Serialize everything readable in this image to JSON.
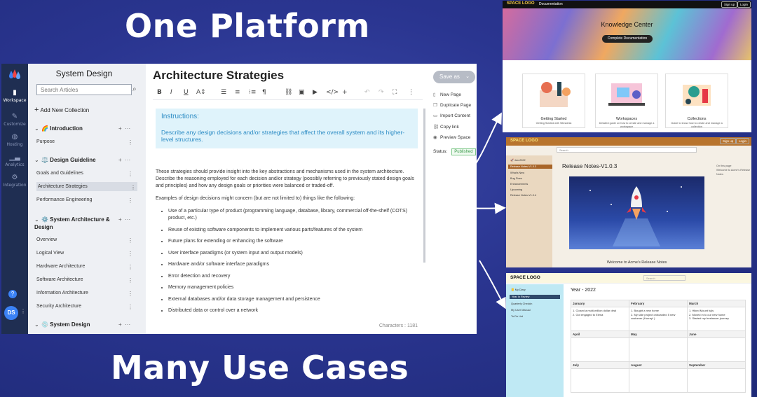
{
  "headlines": {
    "top": "One Platform",
    "bottom": "Many Use Cases"
  },
  "rail": {
    "items": [
      {
        "label": "Workspace",
        "icon": "folder-icon"
      },
      {
        "label": "Customize",
        "icon": "brush-icon"
      },
      {
        "label": "Hosting",
        "icon": "globe-icon"
      },
      {
        "label": "Analytics",
        "icon": "chart-icon"
      },
      {
        "label": "Integration",
        "icon": "plug-icon"
      }
    ],
    "avatar": "DS"
  },
  "sidebar": {
    "title": "System Design",
    "search_placeholder": "Search Articles",
    "add_collection": "Add New Collection",
    "sections": [
      {
        "label": "🌈 Introduction",
        "links": [
          "Purpose"
        ]
      },
      {
        "label": "⚖️ Design Guideline",
        "links": [
          "Goals and Guidelines",
          "Architecture Strategies",
          "Performance Engineering"
        ]
      },
      {
        "label": "⚙️ System Architecture & Design",
        "links": [
          "Overview",
          "Logical View",
          "Hardware Architecture",
          "Software Architecture",
          "Information Architecture",
          "Security Architecture"
        ]
      },
      {
        "label": "💿 System Design",
        "links": []
      }
    ],
    "active_link": "Architecture Strategies"
  },
  "editor": {
    "title": "Architecture Strategies",
    "instructions_heading": "Instructions:",
    "instructions_body": "Describe any design decisions and/or strategies that affect the overall system and its higher-level structures.",
    "paragraph1": "These strategies should provide insight into the key abstractions and mechanisms used in the system architecture. Describe the reasoning employed for each decision and/or strategy (possibly referring to previously stated design goals and principles) and how any design goals or priorities were balanced or traded-off.",
    "paragraph2": "Examples of design decisions might concern (but are not limited to) things like the following:",
    "bullets": [
      "Use of a particular type of product (programming language, database, library, commercial off-the-shelf (COTS) product, etc.)",
      "Reuse of existing software components to implement various parts/features of the system",
      "Future plans for extending or enhancing the software",
      "User interface paradigms (or system input and output models)",
      "Hardware and/or software interface paradigms",
      "Error detection and recovery",
      "Memory management policies",
      "External databases and/or data storage management and persistence",
      "Distributed data or control over a network"
    ],
    "characters_label": "Characters : 1181"
  },
  "right_panel": {
    "save_as": "Save as",
    "actions": [
      "New Page",
      "Duplicate Page",
      "Import Content",
      "Copy link",
      "Preview Space"
    ],
    "status_label": "Status:",
    "status_value": "Published"
  },
  "shot1": {
    "brand": "SPACE LOGO",
    "nav_title": "Documentation",
    "signup": "Sign up",
    "login": "Login",
    "hero_title": "Knowledge Center",
    "hero_cta": "Complete Documentation",
    "cards": [
      {
        "title": "Getting Started",
        "desc": "Getting Started with Sitesdesk"
      },
      {
        "title": "Workspaces",
        "desc": "Detailed guide on how to create and manage a workspace"
      },
      {
        "title": "Collections",
        "desc": "Guide to know how to create and manage a collection"
      }
    ]
  },
  "shot2": {
    "brand": "SPACE LOGO",
    "signup": "Sign up",
    "login": "Login",
    "search_placeholder": "Search",
    "sidebar_items": [
      "🚀 Jan-2022",
      "Release Notes-V1.0.3",
      "What's New",
      "Bug Fixes",
      "Enhancements",
      "Upcoming",
      "Release Notes-V1.0.4"
    ],
    "title": "Release Notes-V1.0.3",
    "caption": "Welcome to Acme's Release Notes",
    "right_text": [
      "On this page",
      "Welcome to Acme's Release Notes"
    ]
  },
  "shot3": {
    "brand": "SPACE LOGO",
    "search_placeholder": "Search",
    "sidebar_items": [
      "📒 My Diary",
      "Year In Review",
      "Quarterly Checkin",
      "My User Manual",
      "To-Do List"
    ],
    "title": "Year - 2022",
    "months": [
      "January",
      "February",
      "March",
      "April",
      "May",
      "June",
      "July",
      "August",
      "September"
    ],
    "entries": {
      "January": [
        "1. Closed a multi-million dollar deal",
        "2. Got engaged to Elena"
      ],
      "February": [
        "1. Bought a new home",
        "2. My side project onboarded 5 new customer (Hurray! )"
      ],
      "March": [
        "1. Hiked Mount fujis",
        "2. Moved in to our new home",
        "3. Started my freelancer journey"
      ]
    }
  }
}
